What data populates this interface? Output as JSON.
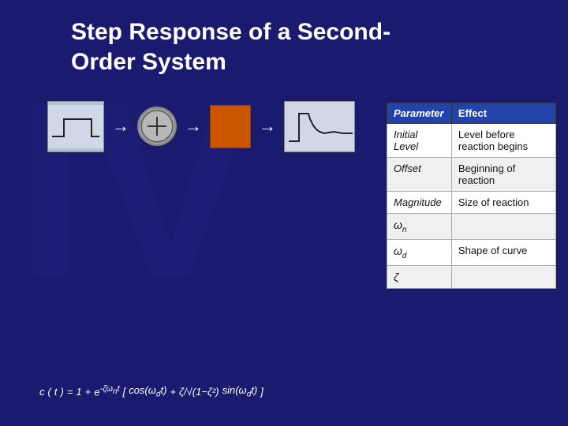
{
  "title": {
    "line1": "Step Response of a Second-",
    "line2": "Order System"
  },
  "table": {
    "headers": [
      "Parameter",
      "Effect"
    ],
    "rows": [
      {
        "parameter": "Initial Level",
        "effect": "Level before reaction begins"
      },
      {
        "parameter": "Offset",
        "effect": "Beginning of reaction"
      },
      {
        "parameter": "Magnitude",
        "effect": "Size of reaction"
      },
      {
        "parameter": "ωn",
        "effect": ""
      },
      {
        "parameter": "ωd",
        "effect": "Shape of curve"
      },
      {
        "parameter": "ζ",
        "effect": ""
      }
    ]
  },
  "diagram": {
    "arrow_right": "→",
    "arrow_plus": "+"
  }
}
